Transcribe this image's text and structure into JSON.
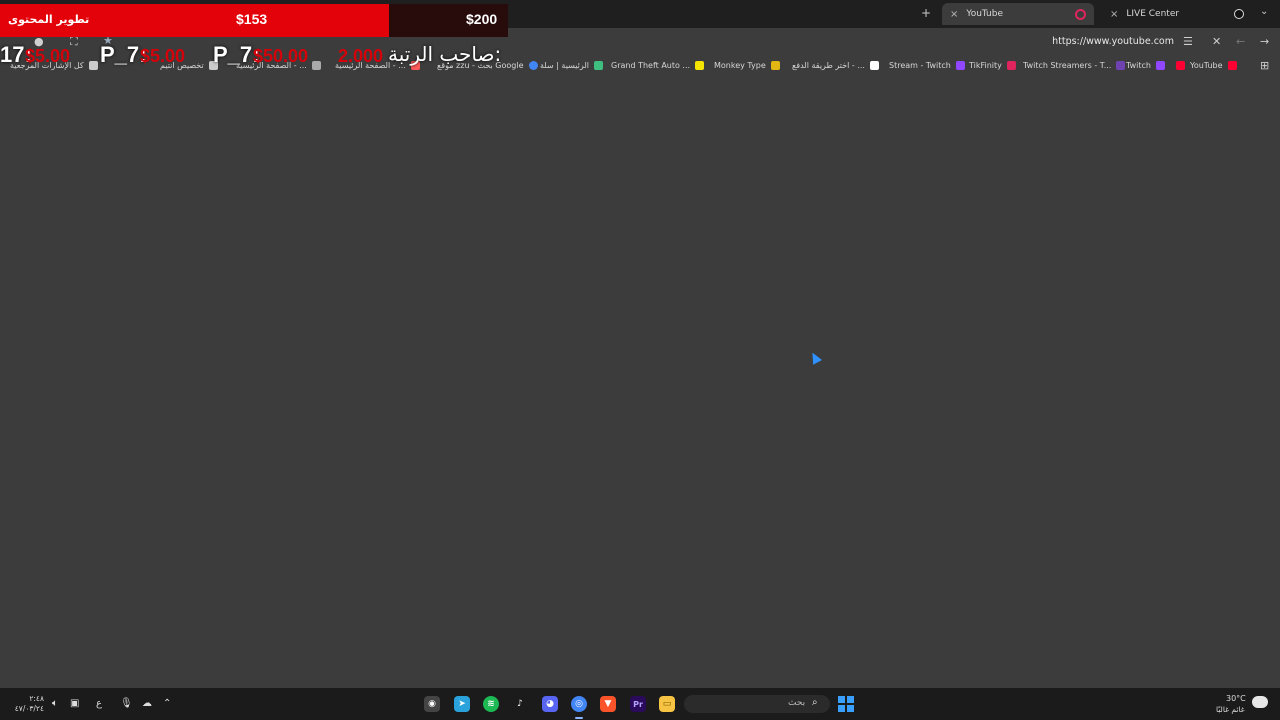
{
  "browser": {
    "tabs": [
      {
        "label": "YouTube",
        "active": true
      },
      {
        "label": "LIVE Center",
        "active": false
      }
    ],
    "new_tab": "+",
    "url": "https://www.youtube.com"
  },
  "bookmarks": [
    {
      "label": "YouTube",
      "icon_color": "#ff0033"
    },
    {
      "label": "Twitch",
      "icon_color": "#9146ff"
    },
    {
      "label": "Twitch Streamers - T...",
      "icon_color": "#9146ff"
    },
    {
      "label": "TikFinity",
      "icon_color": "#e0245e"
    },
    {
      "label": "Stream - Twitch",
      "icon_color": "#9146ff"
    },
    {
      "label": "اختر طريقة الدفع - ...",
      "icon_color": "#ffffff"
    },
    {
      "label": "Monkey Type",
      "icon_color": "#e2b714"
    },
    {
      "label": "Grand Theft Auto ...",
      "icon_color": "#f5e400"
    },
    {
      "label": "الرئيسية | سلة",
      "icon_color": "#3fbf7f"
    },
    {
      "label": "موقع zzu - بحث Google",
      "icon_color": "#4285f4"
    },
    {
      "label": "الصفحة الرئيسية - ...",
      "icon_color": "#ff5a5a"
    },
    {
      "label": "الصفحة الرئيسية - ...",
      "icon_color": "#aaaaaa"
    },
    {
      "label": "تخصيص انتيم",
      "icon_color": "#cccccc"
    },
    {
      "label": "كل الإشارات المرجعية",
      "icon_color": "#cccccc"
    }
  ],
  "overlay": {
    "goal_label": "تطوير المحتوى",
    "goal_current": "$153",
    "goal_target": "$200",
    "goal_progress": 0.765,
    "ticker_title": "صاحب الرتبة:",
    "ticker_items": [
      {
        "text": "17:",
        "style": "white"
      },
      {
        "text": "$5.00",
        "style": "red"
      },
      {
        "text": "P_7:",
        "style": "white"
      },
      {
        "text": "$5.00",
        "style": "red"
      },
      {
        "text": "P_7:",
        "style": "white"
      },
      {
        "text": "$50.00",
        "style": "red"
      },
      {
        "text": "2.000",
        "style": "red"
      }
    ]
  },
  "taskbar": {
    "weather_temp": "30°C",
    "weather_desc": "غائم غالبًا",
    "search_placeholder": "بحث",
    "clock_time": "٢:٤٨",
    "clock_date": "٤٧/٠٣/٢٤",
    "lang": "ع",
    "apps": [
      {
        "name": "obs",
        "color": "#444444",
        "glyph": "◉"
      },
      {
        "name": "telegram",
        "color": "#2aa3dd",
        "glyph": "➤"
      },
      {
        "name": "spotify",
        "color": "#1db954",
        "glyph": "≋"
      },
      {
        "name": "tiktok",
        "color": "#1b1b1b",
        "glyph": "♪"
      },
      {
        "name": "discord",
        "color": "#5865f2",
        "glyph": "◕"
      },
      {
        "name": "chrome",
        "color": "#4285f4",
        "glyph": "◎"
      },
      {
        "name": "brave",
        "color": "#fb542b",
        "glyph": "▼"
      },
      {
        "name": "premiere",
        "color": "#2a0a5a",
        "glyph": "Pr"
      },
      {
        "name": "explorer",
        "color": "#f6c342",
        "glyph": "▭"
      }
    ]
  },
  "colors": {
    "goal_fill": "#e3020a",
    "goal_remaining": "#280c0c",
    "cursor": "#2f90ff"
  }
}
